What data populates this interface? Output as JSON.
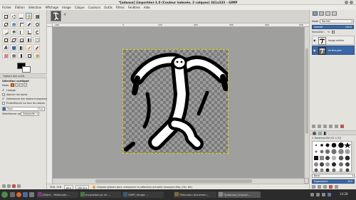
{
  "window": {
    "title": "*[adanse] (importée)-1.0 (Couleur indexée, 2 calques) 341x333 – GIMP"
  },
  "menubar": [
    "Fichier",
    "Édition",
    "Sélection",
    "Affichage",
    "Image",
    "Calque",
    "Couleurs",
    "Outils",
    "Filtres",
    "Fenêtres",
    "Aide"
  ],
  "toolbox": {
    "tabs": [
      "Options des outils"
    ],
    "section_title": "Sélection contiguë",
    "mode_label": "Mode :",
    "options": [
      {
        "label": "Lissage",
        "checked": true
      },
      {
        "label": "Adoucir les bords",
        "checked": false
      },
      {
        "label": "Sélectionner des régions transparentes",
        "checked": true
      },
      {
        "label": "Échantillonner sur tous les calques",
        "checked": false
      }
    ],
    "threshold_label": "Seuil",
    "threshold_value": "15,0",
    "select_by_label": "Sélectionner par",
    "select_by_value": "Composite"
  },
  "rulers": {
    "h_ticks": [
      "-100",
      "0",
      "100",
      "200",
      "300",
      "400",
      "500"
    ]
  },
  "statusbar": {
    "coords": "306, 128",
    "unit": "px",
    "zoom": "100 %",
    "message": "Cliquez-glissez pour remplacer la sélection actuelle (essayez Maj, Ctrl, Alt)"
  },
  "layers": {
    "mode_label": "Mode",
    "mode_value": "Normal",
    "opacity_label": "Opacité",
    "opacity_value": "100,0",
    "lock_label": "Verrouiller :",
    "items": [
      {
        "name": "Image entière",
        "selected": false
      },
      {
        "name": "Arrière-plan",
        "selected": true
      }
    ]
  },
  "brushes": {
    "name": "2. Hardness 050 (51 × 51)",
    "tag_label": "Basic",
    "spacing_label": "Espacement",
    "spacing_value": "10,0"
  },
  "taskbar": {
    "items": [
      {
        "label": "[Slack - FabAcade...",
        "color": "#7a3b7a",
        "active": false
      },
      {
        "label": "Invocation.pi uh ...",
        "color": "#4a7a3a",
        "active": false
      },
      {
        "label": "GIMP_Image ...",
        "color": "#3b5a7a",
        "active": false
      },
      {
        "label": "*Nouveau documen...",
        "color": "#7a6a3a",
        "active": false
      },
      {
        "label": "*[adanse] (import...",
        "color": "#5a5a5a",
        "active": true
      }
    ],
    "clock": "14:28"
  },
  "colors": {
    "selection_blue": "#3a67a6",
    "accent_orange": "#e07b2a"
  }
}
